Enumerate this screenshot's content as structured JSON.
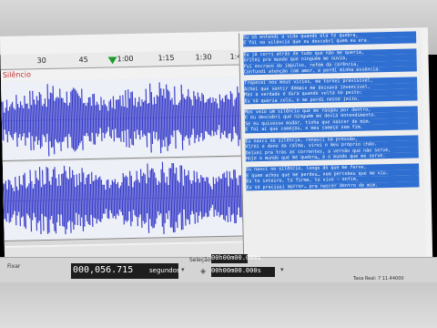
{
  "ruler": {
    "ticks": [
      "30",
      "45",
      "1:00",
      "1:15",
      "1:30",
      "1:45"
    ]
  },
  "track": {
    "label": "Silêncio"
  },
  "lyrics": {
    "stanzas": [
      [
        "Eu só entendi a vida quando ela te quebra,",
        "E foi no silêncio que eu descobri quem eu era."
      ],
      [
        "Eu já corri atrás de tudo que não me queria,",
        "Gritei pro mundo que ninguém me ouvia,",
        "Fui escravo do impulso, refém da carência,",
        "Confundi atenção com amor, e perdi minha essência."
      ],
      [
        "Tropecei nos meus vícios, me tornei previsível,",
        "Achei que sentir demais me deixava invencível,",
        "Mas a verdade é dura quando volta no peito:",
        "Eu só queria colo… e me perdi nesse jeito."
      ],
      [
        "Mas veio um silêncio que me rasgou por dentro,",
        "E eu descobri que ninguém me devia entendimento.",
        "Se eu quisesse mudar, tinha que nascer de mim.",
        "E foi aí que começou, o meu começo sem fim."
      ],
      [
        "Eu nasci no silêncio, renasci na pressão,",
        "Virei o dono da calma, virei o meu próprio chão.",
        "Deixei pra trás as correntes, a versão que não serve,",
        "Hoje o mundo que me quebra… é o mundo que me serve."
      ],
      [
        "Eu nasci no silêncio, longe do que me ferve,",
        "E quem achou que me perdeu… nem percebeu que me viu.",
        "Eu to inteiro, to firme, to vivo — enfim,",
        "Eu só precisei morrer… pra nascer dentro de mim."
      ]
    ]
  },
  "status": {
    "left_label": "Fixar",
    "time_value": "000,056.715",
    "time_unit": "segundos",
    "selection_label": "Seleção",
    "selection_start": "00h00m00.000s",
    "selection_end": "00h00m00.000s",
    "rate_text": "Taxa Real: 7 11.44000"
  },
  "colors": {
    "waveform": "#3a3fc9",
    "selection": "#2f6fd1",
    "playhead": "#1a9d2e"
  }
}
